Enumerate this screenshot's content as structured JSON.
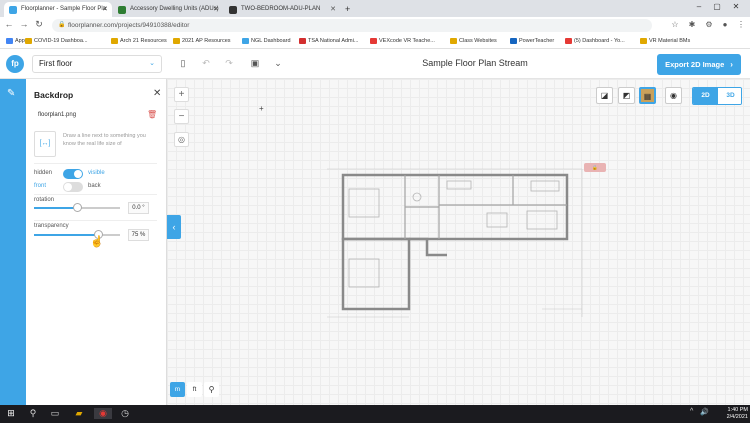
{
  "browser": {
    "tabs": [
      {
        "title": "Floorplanner - Sample Floor Pla",
        "active": true,
        "favicon_color": "#3ea5e6"
      },
      {
        "title": "Accessory Dwelling Units (ADUs)",
        "active": false,
        "favicon_color": "#2e7d32"
      },
      {
        "title": "TWO-BEDROOM-ADU-PLAN",
        "active": false,
        "favicon_color": "#333333"
      }
    ],
    "new_tab_label": "+",
    "url": "floorplanner.com/projects/94910388/editor",
    "bookmarks": [
      {
        "label": "Apps",
        "color": "#4285f4"
      },
      {
        "label": "COVID-19 Dashboa...",
        "color": "#e0a800"
      },
      {
        "label": "Arch 21 Resources",
        "color": "#e0a800"
      },
      {
        "label": "2021 AP Resources",
        "color": "#e0a800"
      },
      {
        "label": "NGL Dashboard",
        "color": "#3ea5e6"
      },
      {
        "label": "TSA National Admi...",
        "color": "#d32f2f"
      },
      {
        "label": "VEXcode VR Teache...",
        "color": "#e53935"
      },
      {
        "label": "Class Websites",
        "color": "#e0a800"
      },
      {
        "label": "PowerTeacher",
        "color": "#1565c0"
      },
      {
        "label": "(5) Dashboard - Yo...",
        "color": "#e53935"
      },
      {
        "label": "VR Material BMs",
        "color": "#e0a800"
      }
    ]
  },
  "header": {
    "floor_selector": "First floor",
    "project_title": "Sample Floor Plan Stream",
    "export_label": "Export 2D Image"
  },
  "panel": {
    "title": "Backdrop",
    "file_name": "floorplan1.png",
    "measure_text": "Draw a line next to something you know the real life size of",
    "visibility": {
      "off_label": "hidden",
      "on_label": "visible",
      "state": "visible"
    },
    "position": {
      "front_label": "front",
      "back_label": "back",
      "state": "front"
    },
    "rotation": {
      "label": "rotation",
      "value": "0.0 °",
      "fraction": 0.5
    },
    "transparency": {
      "label": "transparency",
      "value": "75 %",
      "fraction": 0.75
    }
  },
  "canvas": {
    "view_modes": {
      "two_d": "2D",
      "three_d": "3D",
      "active": "2D"
    },
    "units": {
      "m": "m",
      "ft": "ft"
    },
    "active_unit": "m"
  },
  "taskbar": {
    "time": "1:40 PM",
    "date": "2/4/2021"
  },
  "colors": {
    "accent": "#3ea5e6",
    "danger": "#d9534f",
    "taskbar": "#1b1b1f"
  }
}
